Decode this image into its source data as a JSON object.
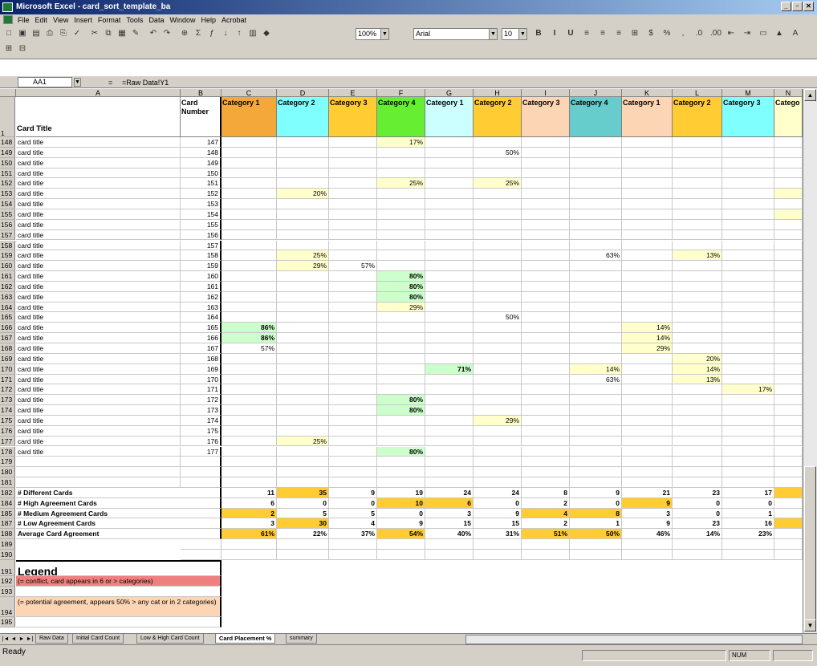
{
  "window": {
    "title": "Microsoft Excel - card_sort_template_ba",
    "controls": [
      "_",
      "▫",
      "✕"
    ]
  },
  "menu": [
    "File",
    "Edit",
    "View",
    "Insert",
    "Format",
    "Tools",
    "Data",
    "Window",
    "Help",
    "Acrobat"
  ],
  "toolbar": {
    "zoom": "100%",
    "font": "Arial",
    "size": "10"
  },
  "formula_bar": {
    "name_box": "AA1",
    "equals": "=",
    "formula": "=Raw Data!Y1"
  },
  "colors": {
    "orange": "#f4a83a",
    "cyan": "#80ffff",
    "yellow": "#ffcc33",
    "green": "#66ee33",
    "lightcyan": "#ccffff",
    "peach": "#fcd5b4",
    "teal": "#66cccc",
    "paleyellow": "#ffffcc",
    "palegreen": "#ccffcc",
    "red": "#f08080"
  },
  "columns": [
    "A",
    "B",
    "C",
    "D",
    "E",
    "F",
    "G",
    "H",
    "I",
    "J",
    "K",
    "L",
    "M",
    "N"
  ],
  "header": {
    "row": "1",
    "a": "Card Title",
    "b": "Card Number",
    "categories": [
      {
        "label": "Category 1",
        "color": "orange"
      },
      {
        "label": "Category 2",
        "color": "cyan"
      },
      {
        "label": "Category 3",
        "color": "yellow"
      },
      {
        "label": "Category 4",
        "color": "green"
      },
      {
        "label": "Category 1",
        "color": "lightcyan"
      },
      {
        "label": "Category 2",
        "color": "yellow"
      },
      {
        "label": "Category 3",
        "color": "peach"
      },
      {
        "label": "Category 4",
        "color": "teal"
      },
      {
        "label": "Category 1",
        "color": "peach"
      },
      {
        "label": "Category 2",
        "color": "yellow"
      },
      {
        "label": "Category 3",
        "color": "cyan"
      },
      {
        "label": "Catego",
        "color": "paleyellow"
      }
    ]
  },
  "rows": [
    {
      "r": "148",
      "t": "card title",
      "n": "147",
      "v": {
        "F": [
          "17%",
          "paleyellow"
        ]
      }
    },
    {
      "r": "149",
      "t": "card title",
      "n": "148",
      "v": {
        "H": [
          "50%",
          ""
        ]
      }
    },
    {
      "r": "150",
      "t": "card title",
      "n": "149",
      "v": {}
    },
    {
      "r": "151",
      "t": "card title",
      "n": "150",
      "v": {}
    },
    {
      "r": "152",
      "t": "card title",
      "n": "151",
      "v": {
        "F": [
          "25%",
          "paleyellow"
        ],
        "H": [
          "25%",
          "paleyellow"
        ]
      }
    },
    {
      "r": "153",
      "t": "card title",
      "n": "152",
      "v": {
        "D": [
          "20%",
          "paleyellow"
        ],
        "N": [
          "",
          "paleyellow"
        ]
      }
    },
    {
      "r": "154",
      "t": "card title",
      "n": "153",
      "v": {}
    },
    {
      "r": "155",
      "t": "card title",
      "n": "154",
      "v": {
        "N": [
          "",
          "paleyellow"
        ]
      }
    },
    {
      "r": "156",
      "t": "card title",
      "n": "155",
      "v": {}
    },
    {
      "r": "157",
      "t": "card title",
      "n": "156",
      "v": {}
    },
    {
      "r": "158",
      "t": "card title",
      "n": "157",
      "v": {}
    },
    {
      "r": "159",
      "t": "card title",
      "n": "158",
      "v": {
        "D": [
          "25%",
          "paleyellow"
        ],
        "J": [
          "63%",
          ""
        ],
        "L": [
          "13%",
          "paleyellow"
        ]
      }
    },
    {
      "r": "160",
      "t": "card title",
      "n": "159",
      "v": {
        "D": [
          "29%",
          "paleyellow"
        ],
        "E": [
          "57%",
          ""
        ]
      }
    },
    {
      "r": "161",
      "t": "card title",
      "n": "160",
      "v": {
        "F": [
          "80%",
          "palegreen"
        ]
      }
    },
    {
      "r": "162",
      "t": "card title",
      "n": "161",
      "v": {
        "F": [
          "80%",
          "palegreen"
        ]
      }
    },
    {
      "r": "163",
      "t": "card title",
      "n": "162",
      "v": {
        "F": [
          "80%",
          "palegreen"
        ]
      }
    },
    {
      "r": "164",
      "t": "card title",
      "n": "163",
      "v": {
        "F": [
          "29%",
          "paleyellow"
        ]
      }
    },
    {
      "r": "165",
      "t": "card title",
      "n": "164",
      "v": {
        "H": [
          "50%",
          ""
        ]
      }
    },
    {
      "r": "166",
      "t": "card title",
      "n": "165",
      "v": {
        "C": [
          "86%",
          "palegreen"
        ],
        "K": [
          "14%",
          "paleyellow"
        ]
      }
    },
    {
      "r": "167",
      "t": "card title",
      "n": "166",
      "v": {
        "C": [
          "86%",
          "palegreen"
        ],
        "K": [
          "14%",
          "paleyellow"
        ]
      }
    },
    {
      "r": "168",
      "t": "card title",
      "n": "167",
      "v": {
        "C": [
          "57%",
          ""
        ],
        "K": [
          "29%",
          "paleyellow"
        ]
      }
    },
    {
      "r": "169",
      "t": "card title",
      "n": "168",
      "v": {
        "L": [
          "20%",
          "paleyellow"
        ]
      }
    },
    {
      "r": "170",
      "t": "card title",
      "n": "169",
      "v": {
        "G": [
          "71%",
          "palegreen"
        ],
        "J": [
          "14%",
          "paleyellow"
        ],
        "L": [
          "14%",
          "paleyellow"
        ]
      }
    },
    {
      "r": "171",
      "t": "card title",
      "n": "170",
      "v": {
        "J": [
          "63%",
          ""
        ],
        "L": [
          "13%",
          "paleyellow"
        ]
      }
    },
    {
      "r": "172",
      "t": "card title",
      "n": "171",
      "v": {
        "M": [
          "17%",
          "paleyellow"
        ]
      }
    },
    {
      "r": "173",
      "t": "card title",
      "n": "172",
      "v": {
        "F": [
          "80%",
          "palegreen"
        ]
      }
    },
    {
      "r": "174",
      "t": "card title",
      "n": "173",
      "v": {
        "F": [
          "80%",
          "palegreen"
        ]
      }
    },
    {
      "r": "175",
      "t": "card title",
      "n": "174",
      "v": {
        "H": [
          "29%",
          "paleyellow"
        ]
      }
    },
    {
      "r": "176",
      "t": "card title",
      "n": "175",
      "v": {}
    },
    {
      "r": "177",
      "t": "card title",
      "n": "176",
      "v": {
        "D": [
          "25%",
          "paleyellow"
        ]
      }
    },
    {
      "r": "178",
      "t": "card title",
      "n": "177",
      "v": {
        "F": [
          "80%",
          "palegreen"
        ]
      }
    },
    {
      "r": "179",
      "t": "",
      "n": "",
      "v": {}
    },
    {
      "r": "180",
      "t": "",
      "n": "",
      "v": {}
    },
    {
      "r": "181",
      "t": "",
      "n": "",
      "v": {}
    }
  ],
  "summary": [
    {
      "r": "182",
      "label": "# Different Cards",
      "vals": [
        "11",
        "35",
        "9",
        "19",
        "24",
        "24",
        "8",
        "9",
        "21",
        "23",
        "17",
        ""
      ],
      "hl": {
        "1": "yellow",
        "11": "yellow"
      }
    },
    {
      "r": "184",
      "label": "# High Agreement Cards",
      "vals": [
        "6",
        "0",
        "0",
        "10",
        "6",
        "0",
        "2",
        "0",
        "9",
        "0",
        "0",
        ""
      ],
      "hl": {
        "3": "yellow",
        "4": "yellow",
        "8": "yellow"
      }
    },
    {
      "r": "185",
      "label": "# Medium Agreement Cards",
      "vals": [
        "2",
        "5",
        "5",
        "0",
        "3",
        "9",
        "4",
        "8",
        "3",
        "0",
        "1",
        ""
      ],
      "hl": {
        "0": "yellow",
        "6": "yellow",
        "7": "yellow"
      }
    },
    {
      "r": "187",
      "label": "# Low Agreement Cards",
      "vals": [
        "3",
        "30",
        "4",
        "9",
        "15",
        "15",
        "2",
        "1",
        "9",
        "23",
        "16",
        ""
      ],
      "hl": {
        "1": "yellow",
        "11": "yellow"
      }
    },
    {
      "r": "188",
      "label": "Average Card Agreement",
      "vals": [
        "61%",
        "22%",
        "37%",
        "54%",
        "40%",
        "31%",
        "51%",
        "50%",
        "46%",
        "14%",
        "23%",
        ""
      ],
      "hl": {
        "0": "yellow",
        "3": "yellow",
        "6": "yellow",
        "7": "yellow"
      }
    }
  ],
  "blank_rows": [
    "189",
    "190"
  ],
  "legend": {
    "r_title": "191",
    "title": "Legend",
    "r1": "192",
    "conflict": "(= conflict, card appears in 6 or > categories)",
    "r_gap": "193",
    "r2": "194",
    "potential": "(= potential agreement, appears 50% > any cat or in 2 categories)",
    "r_last": "195"
  },
  "sheet_tabs": [
    {
      "label": "Raw Data",
      "active": false
    },
    {
      "label": "Initial Card Count",
      "active": false
    },
    {
      "label": "Low & High Card Count",
      "active": false
    },
    {
      "label": "Card Placement %",
      "active": true
    },
    {
      "label": "summary",
      "active": false
    }
  ],
  "status": {
    "text": "Ready",
    "num": "NUM"
  }
}
